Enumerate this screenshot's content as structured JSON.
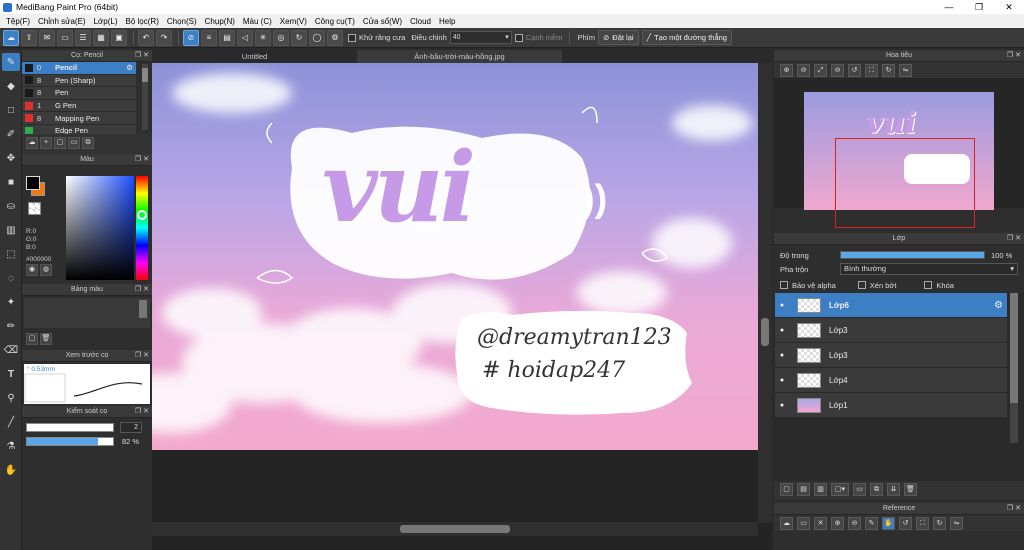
{
  "window": {
    "title": "MediBang Paint Pro (64bit)",
    "minimize": "—",
    "maximize": "❐",
    "close": "✕"
  },
  "menu": [
    "Tệp(F)",
    "Chỉnh sửa(E)",
    "Lớp(L)",
    "Bộ lọc(R)",
    "Chọn(S)",
    "Chụp(N)",
    "Màu (C)",
    "Xem(V)",
    "Công cụ(T)",
    "Cửa sổ(W)",
    "Cloud",
    "Help"
  ],
  "toolbar": {
    "antialias_label": "Khử răng cưa",
    "adjust_label": "Điều chỉnh",
    "adjust_value": "40",
    "smooth_label": "Cạnh mềm",
    "key_label": "Phím",
    "reset_label": "Đặt lại",
    "new_line_label": "Tạo một đường thẳng"
  },
  "brush_panel": {
    "title": "Cọ: Pencil",
    "brushes": [
      {
        "size": "0",
        "name": "Pencil",
        "color": "#1a1a1a",
        "selected": true
      },
      {
        "size": "8",
        "name": "Pen (Sharp)",
        "color": "#1a1a1a"
      },
      {
        "size": "8",
        "name": "Pen",
        "color": "#1a1a1a"
      },
      {
        "size": "1",
        "name": "G Pen",
        "color": "#e03030"
      },
      {
        "size": "8",
        "name": "Mapping Pen",
        "color": "#e03030"
      },
      {
        "size": "",
        "name": "Edge Pen",
        "color": "#2fae4a"
      }
    ]
  },
  "color_panel": {
    "title": "Màu",
    "r": "R:0",
    "g": "G:0",
    "b": "B:0",
    "hex": "#000000",
    "fg": "#000000",
    "bg": "#f07a10"
  },
  "palette_panel": {
    "title": "Bảng màu"
  },
  "preview_panel": {
    "title": "Xem trước cọ",
    "size": "0.53mm"
  },
  "control_panel": {
    "title": "Kiểm soát cọ",
    "size_value": "2",
    "opacity_value": "82 %",
    "opacity_fraction": 0.82
  },
  "canvas": {
    "tabs": [
      "Untitled",
      "Ảnh-bầu-trời-màu-hồng.jpg"
    ],
    "artwork_text": "vui",
    "handle1": "@dreamytran123",
    "handle2": "# hoidap247"
  },
  "navigator": {
    "title": "Hoa tiêu"
  },
  "layer_panel": {
    "title": "Lớp",
    "opacity_label": "Độ trong",
    "opacity_value": "100 %",
    "opacity_fraction": 1.0,
    "blend_label": "Pha trộn",
    "blend_value": "Bình thường",
    "protect_alpha": "Bảo vệ alpha",
    "clipping": "Xén bớt",
    "lock": "Khóa",
    "layers": [
      {
        "name": "Lớp6",
        "selected": true,
        "sky": false
      },
      {
        "name": "Lớp3",
        "selected": false,
        "sky": false
      },
      {
        "name": "Lớp3",
        "selected": false,
        "sky": false
      },
      {
        "name": "Lớp4",
        "selected": false,
        "sky": false
      },
      {
        "name": "Lớp1",
        "selected": false,
        "sky": true
      }
    ]
  },
  "reference_panel": {
    "title": "Reference"
  }
}
